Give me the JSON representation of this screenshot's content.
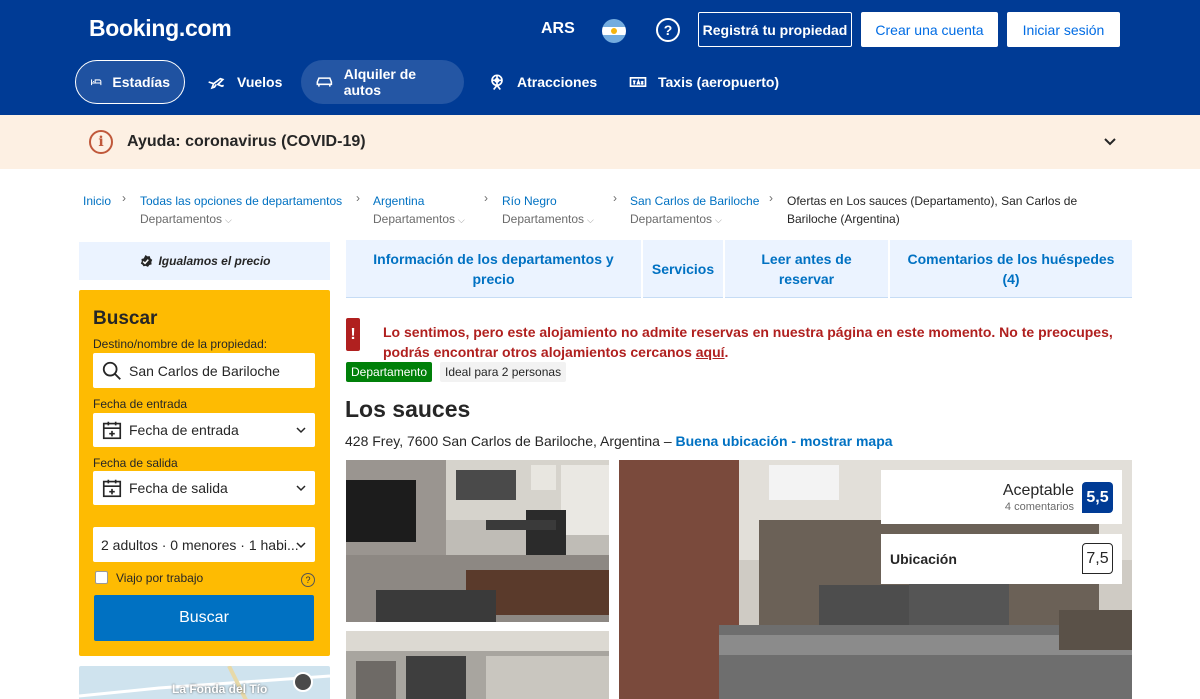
{
  "header": {
    "logo": "Booking.com",
    "currency": "ARS",
    "help_symbol": "?",
    "register_property": "Registrá tu propiedad",
    "create_account": "Crear una cuenta",
    "sign_in": "Iniciar sesión",
    "brand_color": "#003b95"
  },
  "nav": [
    {
      "label": "Estadías",
      "icon": "bed-icon",
      "active": true
    },
    {
      "label": "Vuelos",
      "icon": "plane-icon"
    },
    {
      "label": "Alquiler de autos",
      "icon": "car-icon"
    },
    {
      "label": "Atracciones",
      "icon": "attractions-icon"
    },
    {
      "label": "Taxis (aeropuerto)",
      "icon": "taxi-icon"
    }
  ],
  "alert": {
    "icon_symbol": "i",
    "text": "Ayuda: coronavirus (COVID-19)"
  },
  "breadcrumbs": [
    {
      "label": "Inicio"
    },
    {
      "label": "Todas las opciones de departamentos",
      "sub": "Departamentos"
    },
    {
      "label": "Argentina",
      "sub": "Departamentos"
    },
    {
      "label": "Río Negro",
      "sub": "Departamentos"
    },
    {
      "label": "San Carlos de Bariloche",
      "sub": "Departamentos"
    },
    {
      "label": "Ofertas en Los sauces (Departamento), San Carlos de Bariloche (Argentina)"
    }
  ],
  "price_match": "Igualamos el precio",
  "search": {
    "title": "Buscar",
    "destination_label": "Destino/nombre de la propiedad:",
    "destination_value": "San Carlos de Bariloche",
    "checkin_label": "Fecha de entrada",
    "checkin_value": "Fecha de entrada",
    "checkout_label": "Fecha de salida",
    "checkout_value": "Fecha de salida",
    "guests_value": "2 adultos · 0 menores · 1 habi...",
    "work_trip_label": "Viajo por trabajo",
    "work_trip_help": "?",
    "button": "Buscar"
  },
  "map": {
    "label": "La Fonda del Tío"
  },
  "tabs": [
    "Información de los departamentos y precio",
    "Servicios",
    "Leer antes de reservar",
    "Comentarios de los huéspedes (4)"
  ],
  "error": {
    "icon_symbol": "!",
    "text": "Lo sentimos, pero este alojamiento no admite reservas en nuestra página en este momento. No te preocupes, podrás encontrar otros alojamientos cercanos ",
    "link": "aquí",
    "end": "."
  },
  "badges": {
    "type": "Departamento",
    "ideal": "Ideal para 2 personas"
  },
  "property": {
    "name": "Los sauces",
    "address": "428 Frey, 7600 San Carlos de Bariloche, Argentina – ",
    "location_link": "Buena ubicación - mostrar mapa"
  },
  "rating": {
    "word": "Aceptable",
    "count": "4 comentarios",
    "score": "5,5"
  },
  "location_rating": {
    "label": "Ubicación",
    "score": "7,5"
  }
}
